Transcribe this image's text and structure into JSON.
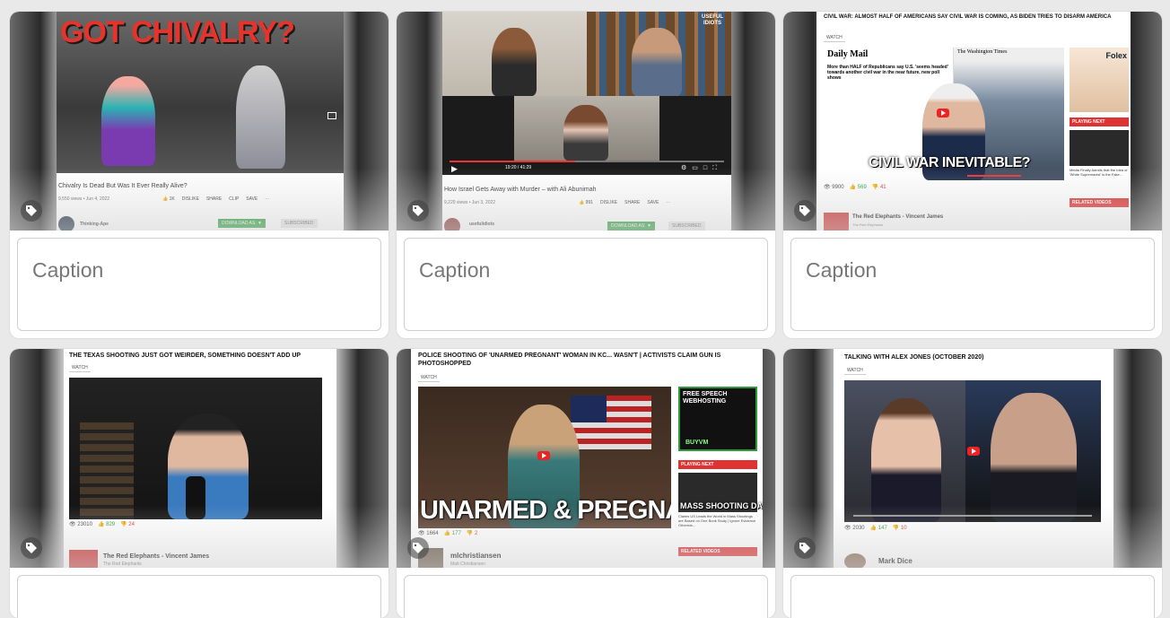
{
  "caption_placeholder": "Caption",
  "cards": [
    {
      "title": "GOT CHIVALRY?",
      "video_title": "Chivalry Is Dead But Was It Ever Really Alive?",
      "meta": "9,550 views • Jun 4, 2022",
      "likes": "1K",
      "dislike": "DISLIKE",
      "share": "SHARE",
      "clip": "CLIP",
      "save": "SAVE",
      "channel": "Thinking-Ape",
      "download": "DOWNLOAD AS: ▼",
      "subscribed": "SUBSCRIBED"
    },
    {
      "badge": "USEFUL IDIOTS",
      "time": "19:20 / 41:29",
      "video_title": "How Israel Gets Away with Murder – with Ali Abunimah",
      "meta": "9,229 views • Jun 3, 2022",
      "likes": "991",
      "dislike": "DISLIKE",
      "share": "SHARE",
      "save": "SAVE",
      "channel": "usefulidiots",
      "download": "DOWNLOAD AS: ▼",
      "subscribed": "SUBSCRIBED"
    },
    {
      "header": "CIVIL WAR: ALMOST HALF OF AMERICANS SAY CIVIL WAR IS COMING, AS BIDEN TRIES TO DISARM AMERICA",
      "watch": "WATCH",
      "paper": "Daily Mail",
      "paper2": "The Washington Times",
      "headline": "More than HALF of Republicans say U.S. 'seems headed' towards another civil war in the near future, new poll shows",
      "overlay": "CIVIL WAR INEVITABLE?",
      "views": "9900",
      "likes": "569",
      "dislikes": "41",
      "playing_next": "PLAYING NEXT",
      "side_item": "Media Finally Admits that the Idea of 'White Supremacist' is the Fake...",
      "related": "RELATED VIDEOS",
      "channel": "The Red Elephants - Vincent James",
      "channel_sub": "The Red Elephants",
      "ad": "Folex"
    },
    {
      "header": "THE TEXAS SHOOTING JUST GOT WEIRDER, SOMETHING DOESN'T ADD UP",
      "watch": "WATCH",
      "views": "23010",
      "likes": "829",
      "dislikes": "24",
      "channel": "The Red Elephants - Vincent James",
      "channel_sub": "The Red Elephants"
    },
    {
      "header": "POLICE SHOOTING OF 'UNARMED PREGNANT' WOMAN IN KC... WASN'T | ACTIVISTS CLAIM GUN IS PHOTOSHOPPED",
      "watch": "WATCH",
      "overlay": "UNARMED & PREGNANT",
      "ad_title": "FREE SPEECH WEBHOSTING",
      "ad_brand": "BUYVM",
      "playing_next": "PLAYING NEXT",
      "side_overlay": "MASS SHOOTING DATA",
      "side_item": "Claims US Leads the World in Mass Shootings are Based on One Bunk Study | Ignore Evidence Otherwis...",
      "related": "RELATED VIDEOS",
      "views": "1664",
      "likes": "177",
      "dislikes": "2",
      "channel": "mlchristiansen",
      "channel_sub": "Matt Christiansen"
    },
    {
      "header": "TALKING WITH ALEX JONES (OCTOBER 2020)",
      "watch": "WATCH",
      "views": "2030",
      "likes": "147",
      "dislikes": "10",
      "channel": "Mark Dice"
    }
  ]
}
